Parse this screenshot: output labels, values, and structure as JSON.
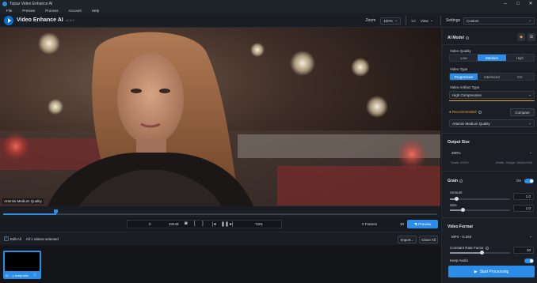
{
  "window": {
    "title": "Topaz Video Enhance AI"
  },
  "menu": [
    "File",
    "Preview",
    "Process",
    "Account",
    "Help"
  ],
  "header": {
    "brand": "Video Enhance AI",
    "version": "v2.6.4",
    "zoom_label": "Zoom",
    "zoom_value": "100%",
    "view_label": "View",
    "settings_label": "Settings",
    "settings_value": "Custom"
  },
  "video": {
    "quality_tag": "Artemis Medium Quality"
  },
  "controls": {
    "start_frame": "0",
    "end_frame": "33449",
    "current_frame": "7201",
    "frames_label": "# Frames",
    "frames_value": "30",
    "preview_label": "Preview"
  },
  "queue": {
    "edit_all": "Edit All",
    "selected_text": "All 1 videos selected",
    "import_label": "Import...",
    "close_all_label": "Close All",
    "item_name": "...) dusty.mkv"
  },
  "panel": {
    "ai_model_title": "AI Model",
    "video_quality_label": "Video Quality",
    "quality_options": [
      "Low",
      "Medium",
      "High"
    ],
    "quality_selected": 1,
    "video_type_label": "Video Type",
    "type_options": [
      "Progressive",
      "Interlaced",
      "CG"
    ],
    "type_selected": 0,
    "artifact_label": "Video Artifact Type",
    "artifact_value": "High Compression",
    "recommended_label": "Recommended",
    "compare_label": "Compare",
    "model_value": "Artemis Medium Quality",
    "output_size_title": "Output Size",
    "output_size_value": "200%",
    "scale_text": "Scale: 200%",
    "wh_text": "Width, Height: 3840x2160",
    "grain_title": "Grain",
    "grain_toggle": "On",
    "amount_label": "Amount",
    "amount_value": "1.0",
    "size_label": "Size",
    "size_value": "1.0",
    "video_format_title": "Video Format",
    "format_value": "MP4 - H.264",
    "crf_label": "Constant Rate Factor",
    "crf_value": "20",
    "keep_audio_label": "Keep Audio",
    "start_label": "Start Processing"
  },
  "colors": {
    "accent": "#2b8de8",
    "bg": "#14171c",
    "panel": "#1b1f25"
  }
}
